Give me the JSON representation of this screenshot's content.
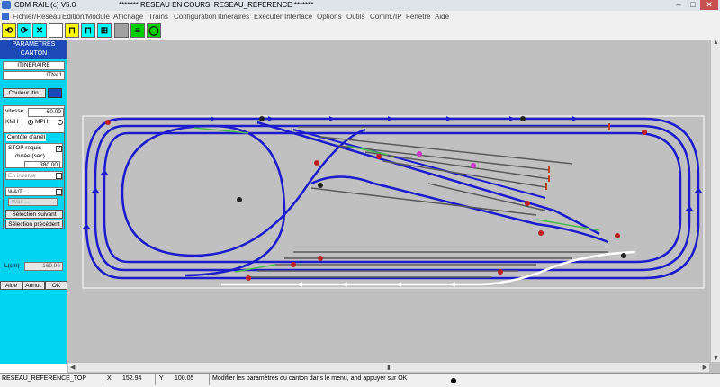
{
  "window": {
    "app_title": "CDM RAIL (c) V5.0",
    "doc_title": "******* RESEAU EN COURS: RESEAU_REFERENCE *******",
    "buttons": {
      "minimize": "–",
      "maximize": "□",
      "close": "✕"
    }
  },
  "menu": [
    "Fichier/Reseau",
    "Edition/Module",
    "Affichage",
    "Trains",
    "Configuration",
    "Itinéraires",
    "Exécuter",
    "Interface",
    "Options",
    "Outils",
    "Comm./IP",
    "Fenêtre",
    "Aide"
  ],
  "toolbar": [
    {
      "icon": "loop-icon",
      "glyph": "⟲",
      "bg": "#ffff00"
    },
    {
      "icon": "loop-arrow-icon",
      "glyph": "⟳",
      "bg": "#00ffff"
    },
    {
      "icon": "cross-loop-icon",
      "glyph": "✕",
      "bg": "#00ffff"
    },
    {
      "icon": "pause-icon",
      "glyph": "",
      "bg": "#ffffff"
    },
    {
      "icon": "train-yellow-icon",
      "glyph": "⊓",
      "bg": "#ffff00"
    },
    {
      "icon": "train-cyan-icon",
      "glyph": "⊓",
      "bg": "#00ffff"
    },
    {
      "icon": "signal-icon",
      "glyph": "⊞",
      "bg": "#00ffff"
    },
    {
      "icon": "gray-block-icon",
      "glyph": "",
      "bg": "#a0a0a0"
    },
    {
      "icon": "track-green-icon",
      "glyph": "≡",
      "bg": "#00cc00"
    },
    {
      "icon": "ellipse-icon",
      "glyph": "◯",
      "bg": "#00cc00"
    }
  ],
  "panel": {
    "header_line1": "PARAMETRES",
    "header_line2": "CANTON",
    "itineraire_label": "ITINERAIRE",
    "itineraire_value": "ITN#1",
    "couleur_label": "Couleur Itin.",
    "couleur_swatch": "#1c49b8",
    "vitesse_label": "vitesse",
    "vitesse_value": "60.00",
    "kmh_label": "KMH",
    "mph_label": "MPH",
    "controle_label": "Contôle d'arrêt",
    "stop_label": "STOP requis",
    "stop_checked": "✓",
    "duree_label": "durée (sec)",
    "duree_value": "380.00",
    "rebroussement_label": "En inverse",
    "wait_label": "WAIT",
    "wait_field": "Wait ...",
    "selection_suivant": "Sélection suivant",
    "selection_precedent": "Sélection précédent",
    "length_label": "L(cm)",
    "length_value": "169.96",
    "btn_aide": "Aide",
    "btn_annul": "Annul.",
    "btn_ok": "OK"
  },
  "status": {
    "file": "RESEAU_REFERENCE_TOP",
    "x_label": "X",
    "x_value": "152.94",
    "y_label": "Y",
    "y_value": "100.05",
    "message": "Modifier les paramètres du canton dans le menu, and appuyer sur OK"
  },
  "colors": {
    "track_route": "#1c1ccc",
    "track_plain": "#5a5a5a",
    "track_selected": "#ffffff",
    "track_siding": "#4db84d",
    "layout_bg": "#c0c0c0"
  }
}
